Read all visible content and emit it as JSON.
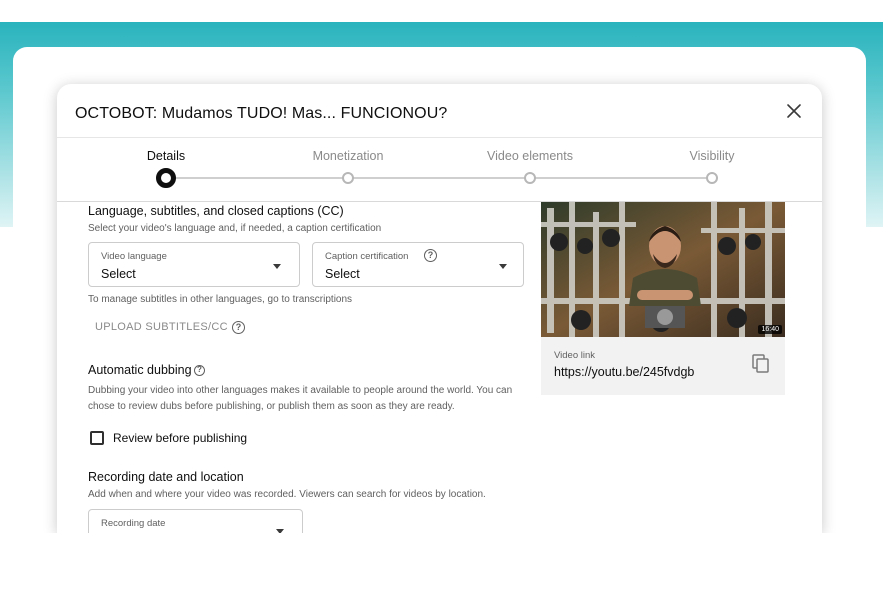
{
  "dialog": {
    "title": "OCTOBOT: Mudamos TUDO! Mas... FUNCIONOU?"
  },
  "steps": [
    {
      "label": "Details",
      "active": true
    },
    {
      "label": "Monetization",
      "active": false
    },
    {
      "label": "Video elements",
      "active": false
    },
    {
      "label": "Visibility",
      "active": false
    }
  ],
  "captions": {
    "title": "Language, subtitles, and closed captions (CC)",
    "subtitle": "Select your video's language and, if needed, a caption certification",
    "video_language": {
      "label": "Video language",
      "value": "Select"
    },
    "caption_certification": {
      "label": "Caption certification",
      "value": "Select"
    },
    "transcription_note": "To manage subtitles in other languages, go to transcriptions",
    "upload_label": "UPLOAD SUBTITLES/CC"
  },
  "dubbing": {
    "title": "Automatic dubbing",
    "description_line1": "Dubbing your video into other languages makes it available to people around the world. You can",
    "description_line2": "chose to review dubs before publishing, or publish them as soon as they are ready.",
    "checkbox_label": "Review before publishing",
    "checked": false
  },
  "recording": {
    "title": "Recording date and location",
    "subtitle": "Add when and where your video was recorded. Viewers can search for videos by location.",
    "date_label": "Recording date"
  },
  "preview": {
    "duration": "16:40",
    "link_label": "Video link",
    "link_url": "https://youtu.be/245fvdgb"
  },
  "icons": {
    "close": "close-icon",
    "help": "help-circle-icon",
    "dropdown": "caret-down-icon",
    "copy": "copy-icon"
  },
  "colors": {
    "background_teal": "#29b3bd",
    "active_step": "#0f0f0f",
    "inactive_step": "#8a8a8a"
  }
}
